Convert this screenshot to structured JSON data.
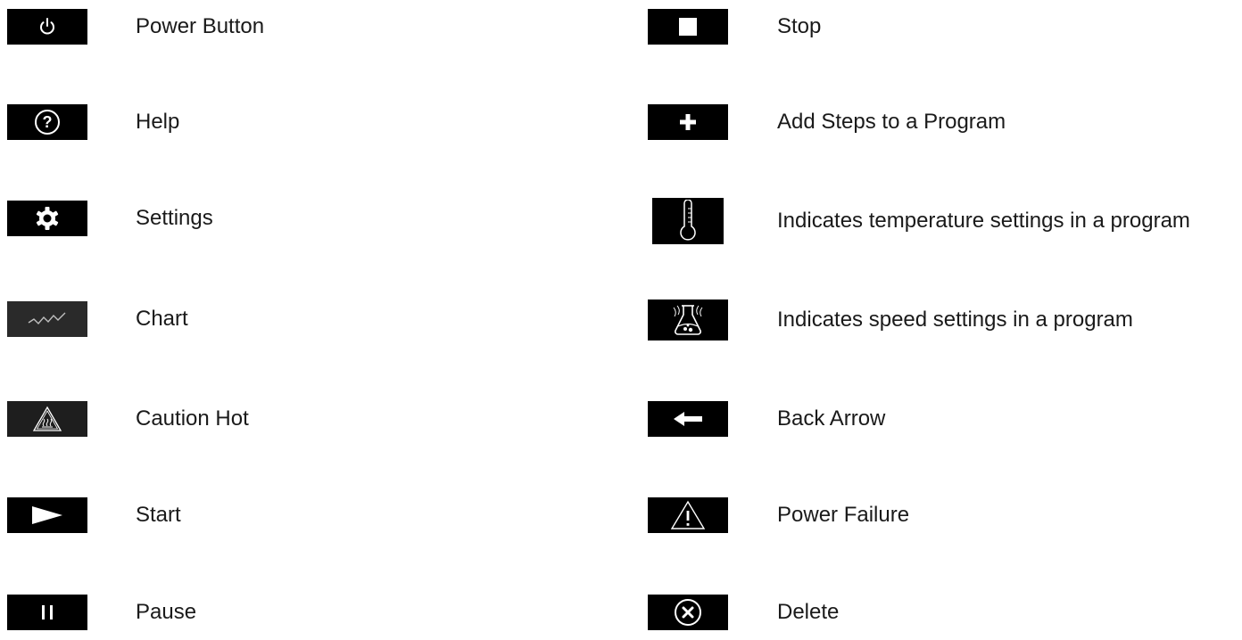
{
  "left": [
    {
      "icon": "power-icon",
      "label": "Power Button"
    },
    {
      "icon": "help-icon",
      "label": "Help"
    },
    {
      "icon": "gear-icon",
      "label": "Settings"
    },
    {
      "icon": "chart-icon",
      "label": "Chart"
    },
    {
      "icon": "caution-hot-icon",
      "label": "Caution Hot"
    },
    {
      "icon": "play-icon",
      "label": "Start"
    },
    {
      "icon": "pause-icon",
      "label": "Pause"
    }
  ],
  "right": [
    {
      "icon": "stop-icon",
      "label": "Stop"
    },
    {
      "icon": "plus-icon",
      "label": "Add Steps to a Program"
    },
    {
      "icon": "thermometer-icon",
      "label": "Indicates temperature settings in a program"
    },
    {
      "icon": "flask-icon",
      "label": "Indicates speed settings in a program"
    },
    {
      "icon": "back-arrow-icon",
      "label": "Back Arrow"
    },
    {
      "icon": "warning-icon",
      "label": "Power Failure"
    },
    {
      "icon": "delete-icon",
      "label": "Delete"
    }
  ],
  "colors": {
    "icon_background": "#000000",
    "icon_foreground": "#ffffff",
    "text": "#1a1a1a"
  }
}
